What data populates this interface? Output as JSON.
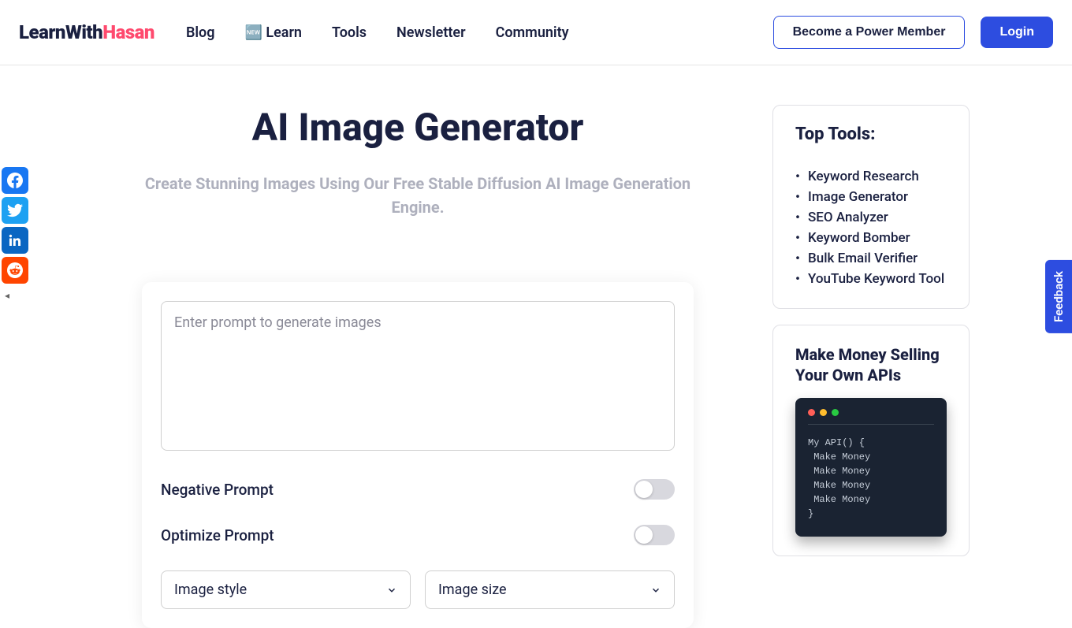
{
  "logo": {
    "part1": "LearnWith",
    "part2": "Hasan"
  },
  "nav": {
    "blog": "Blog",
    "learn": "🆕 Learn",
    "tools": "Tools",
    "newsletter": "Newsletter",
    "community": "Community"
  },
  "header_buttons": {
    "member": "Become a Power Member",
    "login": "Login"
  },
  "page": {
    "title": "AI Image Generator",
    "subtitle": "Create Stunning Images Using Our Free Stable Diffusion AI Image Generation Engine."
  },
  "form": {
    "prompt_placeholder": "Enter prompt to generate images",
    "negative_prompt_label": "Negative Prompt",
    "optimize_prompt_label": "Optimize Prompt",
    "image_style_label": "Image style",
    "image_size_label": "Image size"
  },
  "sidebar": {
    "top_tools_title": "Top Tools:",
    "tools": [
      "Keyword Research",
      "Image Generator",
      "SEO Analyzer",
      "Keyword Bomber",
      "Bulk Email Verifier",
      "YouTube Keyword Tool"
    ],
    "promo_title": "Make Money Selling Your Own APIs",
    "code_lines": "My API() {\n Make Money\n Make Money\n Make Money\n Make Money\n}"
  },
  "feedback_label": "Feedback"
}
